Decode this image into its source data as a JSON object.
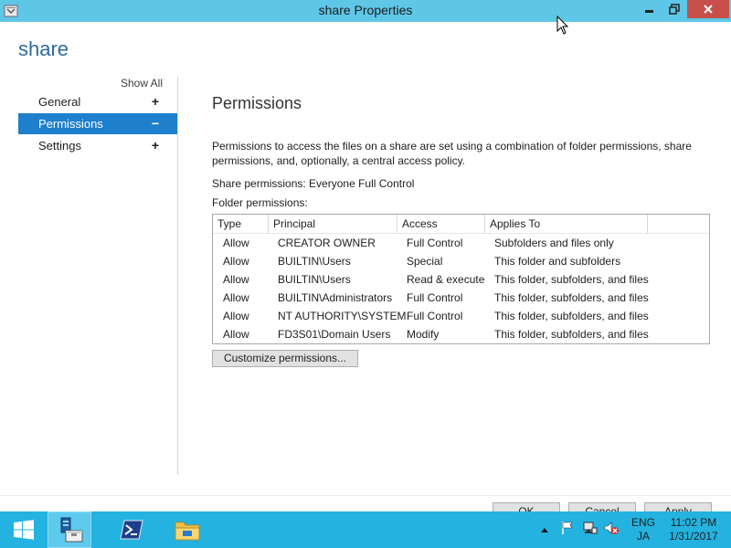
{
  "window": {
    "title": "share Properties",
    "heading": "share"
  },
  "sidebar": {
    "show_all": "Show All",
    "items": [
      {
        "label": "General",
        "symbol": "+"
      },
      {
        "label": "Permissions",
        "symbol": "−"
      },
      {
        "label": "Settings",
        "symbol": "+"
      }
    ]
  },
  "main": {
    "section_title": "Permissions",
    "description": "Permissions to access the files on a share are set using a combination of folder permissions, share permissions, and, optionally, a central access policy.",
    "share_permissions": "Share permissions: Everyone Full Control",
    "folder_permissions_label": "Folder permissions:",
    "table": {
      "headers": [
        "Type",
        "Principal",
        "Access",
        "Applies To"
      ],
      "rows": [
        [
          "Allow",
          "CREATOR OWNER",
          "Full Control",
          "Subfolders and files only"
        ],
        [
          "Allow",
          "BUILTIN\\Users",
          "Special",
          "This folder and subfolders"
        ],
        [
          "Allow",
          "BUILTIN\\Users",
          "Read & execute",
          "This folder, subfolders, and files"
        ],
        [
          "Allow",
          "BUILTIN\\Administrators",
          "Full Control",
          "This folder, subfolders, and files"
        ],
        [
          "Allow",
          "NT AUTHORITY\\SYSTEM",
          "Full Control",
          "This folder, subfolders, and files"
        ],
        [
          "Allow",
          "FD3S01\\Domain Users",
          "Modify",
          "This folder, subfolders, and files"
        ]
      ]
    },
    "customize_button": "Customize permissions..."
  },
  "footer": {
    "ok": "OK",
    "cancel": "Cancel",
    "apply": "Apply"
  },
  "taskbar": {
    "apps": [
      "start-icon",
      "server-manager-icon",
      "powershell-icon",
      "file-explorer-icon"
    ],
    "lang_top": "ENG",
    "lang_bottom": "JA",
    "time": "11:02 PM",
    "date": "1/31/2017"
  },
  "colors": {
    "titlebar": "#5ec7e8",
    "accent": "#1e7fcc",
    "taskbar": "#24b3e0",
    "close": "#c7504c"
  }
}
